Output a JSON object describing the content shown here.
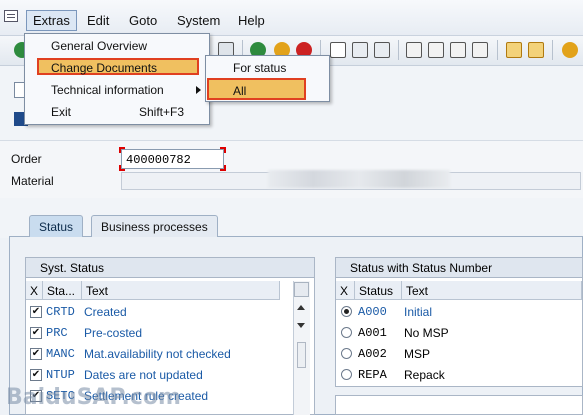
{
  "menubar": {
    "items": [
      {
        "label": "Extras",
        "accel": "E"
      },
      {
        "label": "Edit",
        "accel": "E"
      },
      {
        "label": "Goto",
        "accel": "G"
      },
      {
        "label": "System",
        "accel": "y"
      },
      {
        "label": "Help",
        "accel": "H"
      }
    ]
  },
  "extras_menu": {
    "items": [
      {
        "label": "General Overview"
      },
      {
        "label": "Change Documents"
      },
      {
        "label": "Technical information"
      },
      {
        "label": "Exit",
        "shortcut": "Shift+F3"
      }
    ]
  },
  "change_documents_submenu": {
    "items": [
      {
        "label": "For status"
      },
      {
        "label": "All"
      }
    ]
  },
  "form": {
    "order_label": "Order",
    "order_value": "400000782",
    "material_label": "Material"
  },
  "tabs": [
    {
      "label": "Status"
    },
    {
      "label": "Business processes"
    }
  ],
  "syst_status": {
    "title": "Syst. Status",
    "columns": [
      "X",
      "Sta...",
      "Text"
    ],
    "rows": [
      {
        "checked": true,
        "status": "CRTD",
        "text": "Created"
      },
      {
        "checked": true,
        "status": "PRC",
        "text": "Pre-costed"
      },
      {
        "checked": true,
        "status": "MANC",
        "text": "Mat.availability not checked"
      },
      {
        "checked": true,
        "status": "NTUP",
        "text": "Dates are not updated"
      },
      {
        "checked": true,
        "status": "SETC",
        "text": "Settlement rule created"
      }
    ]
  },
  "status_number": {
    "title": "Status with Status Number",
    "columns": [
      "X",
      "Status",
      "Text"
    ],
    "rows": [
      {
        "selected": true,
        "status": "A000",
        "text": "Initial"
      },
      {
        "selected": false,
        "status": "A001",
        "text": "No MSP"
      },
      {
        "selected": false,
        "status": "A002",
        "text": "MSP"
      },
      {
        "selected": false,
        "status": "REPA",
        "text": "Repack"
      }
    ]
  },
  "watermark": "BaiduSAP.com",
  "colors": {
    "highlight": "#f0c060",
    "highlight_border": "#e04020",
    "link_blue": "#1a5aa6"
  }
}
